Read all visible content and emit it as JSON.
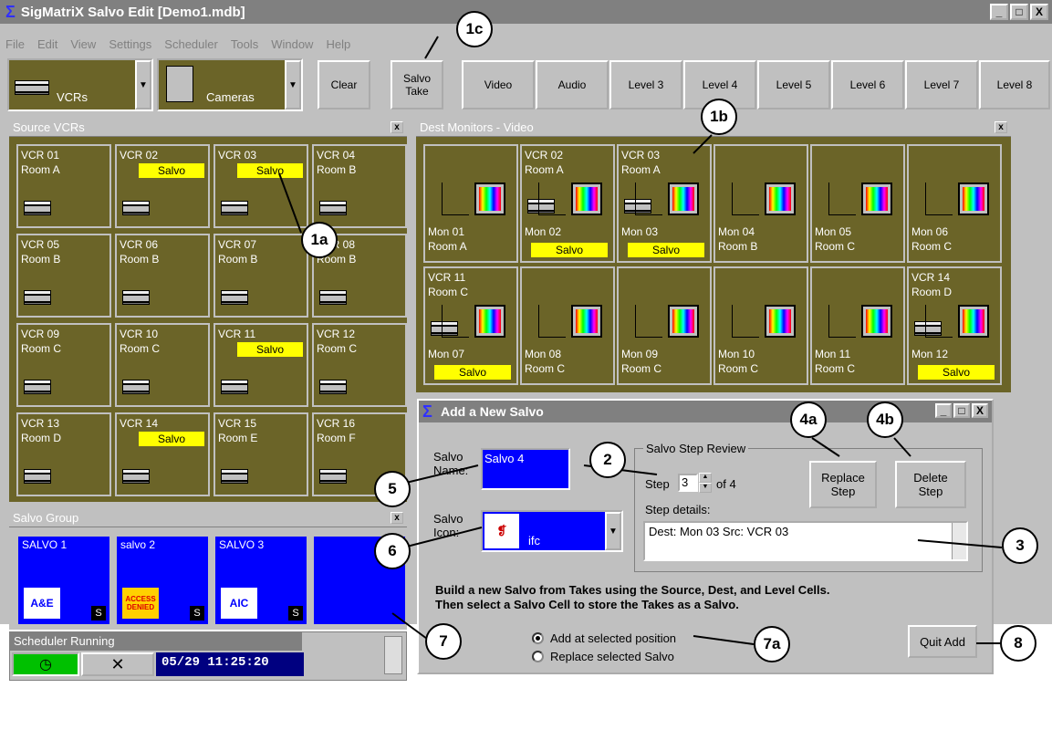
{
  "app": {
    "title": "SigMatriX  Salvo Edit  [Demo1.mdb]",
    "window_buttons": [
      "_",
      "□",
      "X"
    ]
  },
  "menu": [
    "File",
    "Edit",
    "View",
    "Settings",
    "Scheduler",
    "Tools",
    "Window",
    "Help"
  ],
  "toolbar": {
    "source_combo": "VCRs",
    "dest_combo": "Cameras",
    "clear": "Clear",
    "salvo_take_1": "Salvo",
    "salvo_take_2": "Take",
    "levels": [
      "Video",
      "Audio",
      "Level 3",
      "Level 4",
      "Level 5",
      "Level 6",
      "Level 7",
      "Level 8"
    ]
  },
  "source_panel": {
    "title": "Source VCRs",
    "close": "x",
    "cells": [
      {
        "name": "VCR 01",
        "room": "Room A",
        "salvo": ""
      },
      {
        "name": "VCR 02",
        "room": "",
        "salvo": "Salvo"
      },
      {
        "name": "VCR 03",
        "room": "",
        "salvo": "Salvo"
      },
      {
        "name": "VCR 04",
        "room": "Room B",
        "salvo": ""
      },
      {
        "name": "VCR 05",
        "room": "Room B",
        "salvo": ""
      },
      {
        "name": "VCR 06",
        "room": "Room B",
        "salvo": ""
      },
      {
        "name": "VCR 07",
        "room": "Room B",
        "salvo": ""
      },
      {
        "name": "VCR 08",
        "room": "Room B",
        "salvo": ""
      },
      {
        "name": "VCR 09",
        "room": "Room C",
        "salvo": ""
      },
      {
        "name": "VCR 10",
        "room": "Room C",
        "salvo": ""
      },
      {
        "name": "VCR 11",
        "room": "",
        "salvo": "Salvo"
      },
      {
        "name": "VCR 12",
        "room": "Room C",
        "salvo": ""
      },
      {
        "name": "VCR 13",
        "room": "Room D",
        "salvo": ""
      },
      {
        "name": "VCR 14",
        "room": "",
        "salvo": "Salvo"
      },
      {
        "name": "VCR 15",
        "room": "Room E",
        "salvo": ""
      },
      {
        "name": "VCR 16",
        "room": "Room F",
        "salvo": ""
      }
    ]
  },
  "dest_panel": {
    "title": "Dest Monitors - Video",
    "close": "x",
    "cells": [
      {
        "src": "",
        "src_room": "",
        "mon": "Mon 01",
        "room": "Room A",
        "salvo": ""
      },
      {
        "src": "VCR 02",
        "src_room": "Room A",
        "mon": "Mon 02",
        "room": "",
        "salvo": "Salvo"
      },
      {
        "src": "VCR 03",
        "src_room": "Room A",
        "mon": "Mon 03",
        "room": "",
        "salvo": "Salvo"
      },
      {
        "src": "",
        "src_room": "",
        "mon": "Mon 04",
        "room": "Room B",
        "salvo": ""
      },
      {
        "src": "",
        "src_room": "",
        "mon": "Mon 05",
        "room": "Room C",
        "salvo": ""
      },
      {
        "src": "",
        "src_room": "",
        "mon": "Mon 06",
        "room": "Room C",
        "salvo": ""
      },
      {
        "src": "VCR 11",
        "src_room": "Room C",
        "mon": "Mon 07",
        "room": "",
        "salvo": "Salvo"
      },
      {
        "src": "",
        "src_room": "",
        "mon": "Mon 08",
        "room": "Room C",
        "salvo": ""
      },
      {
        "src": "",
        "src_room": "",
        "mon": "Mon 09",
        "room": "Room C",
        "salvo": ""
      },
      {
        "src": "",
        "src_room": "",
        "mon": "Mon 10",
        "room": "Room C",
        "salvo": ""
      },
      {
        "src": "",
        "src_room": "",
        "mon": "Mon 11",
        "room": "Room C",
        "salvo": ""
      },
      {
        "src": "VCR 14",
        "src_room": "Room D",
        "mon": "Mon 12",
        "room": "",
        "salvo": "Salvo"
      }
    ]
  },
  "salvo_group": {
    "title": "Salvo Group",
    "close": "x",
    "cells": [
      {
        "name": "SALVO 1",
        "logo": "A&E",
        "flag": "S"
      },
      {
        "name": "salvo 2",
        "logo": "ACCESS DENIED",
        "flag": "S"
      },
      {
        "name": "SALVO 3",
        "logo": "AIC",
        "flag": "S"
      },
      {
        "name": "",
        "logo": "",
        "flag": ""
      }
    ]
  },
  "scheduler": {
    "title": "Scheduler Running",
    "clock": "05/29  11:25:20"
  },
  "dialog": {
    "title": "Add a New Salvo",
    "salvo_name_label1": "Salvo",
    "salvo_name_label2": "Name:",
    "salvo_name": "Salvo 4",
    "salvo_icon_label1": "Salvo",
    "salvo_icon_label2": "Icon:",
    "icon_name": "ifc",
    "review_group": "Salvo Step Review",
    "step_label": "Step",
    "step_value": "3",
    "of_label": "of 4",
    "step_details_label": "Step details:",
    "step_details": "Dest: Mon 03  Src: VCR 03",
    "replace_1": "Replace",
    "replace_2": "Step",
    "delete_1": "Delete",
    "delete_2": "Step",
    "instructions_1": "Build a new Salvo from Takes using the Source, Dest, and Level Cells.",
    "instructions_2": "Then select a Salvo Cell to store the Takes as a Salvo.",
    "opt_add": "Add at selected position",
    "opt_replace": "Replace selected Salvo",
    "quit": "Quit Add",
    "selected_option": "add"
  },
  "callouts": [
    "1a",
    "1b",
    "1c",
    "2",
    "3",
    "4a",
    "4b",
    "5",
    "6",
    "7",
    "7a",
    "8"
  ]
}
